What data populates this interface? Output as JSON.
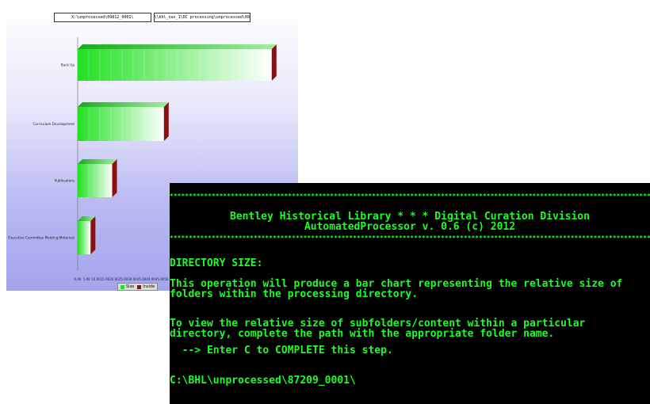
{
  "chart_window": {
    "title_left": "X:\\unprocessed\\09812_0001\\",
    "title_right": "\\\\bhl_nas_1\\DC processing\\unprocessed\\09812_0001\\"
  },
  "chart_data": {
    "type": "bar",
    "orientation": "horizontal",
    "categories": [
      "Back Up",
      "Curriculum Development",
      "Publications",
      "Executive Committee Meeting Materials"
    ],
    "series": [
      {
        "name": "Size",
        "values": [
          90,
          40,
          16,
          6
        ]
      }
    ],
    "x_tick_labels": [
      "0.00",
      "5.00",
      "10.00",
      "15.00",
      "20.00",
      "25.00",
      "30.00",
      "35.00",
      "40.00",
      "45.00",
      "50.00"
    ],
    "legend": [
      "Size",
      "Inside"
    ],
    "legend_position": "bottom",
    "colors": {
      "bar": "#22e022",
      "bar_end": "#ffffff",
      "edge": "#8b1010",
      "background_top": "#ffffff",
      "background_bottom": "#a4a4ee"
    }
  },
  "console": {
    "border_stars": "*****************************************************************************************************************************************",
    "header_line1": "Bentley Historical Library * * * Digital Curation Division",
    "header_line2": "AutomatedProcessor v. 0.6 (c) 2012",
    "section_title": "DIRECTORY SIZE:",
    "para1_line1": "This operation will produce a bar chart representing the relative size of",
    "para1_line2": "folders within the processing directory.",
    "para2_line1": "To view the relative size of subfolders/content within a particular",
    "para2_line2": "directory, complete the path with the appropriate folder name.",
    "instruction": "  --> Enter C to COMPLETE this step.",
    "prompt": "C:\\BHL\\unprocessed\\87209_0001\\",
    "text_color": "#1dfc27",
    "background_color": "#000000"
  }
}
